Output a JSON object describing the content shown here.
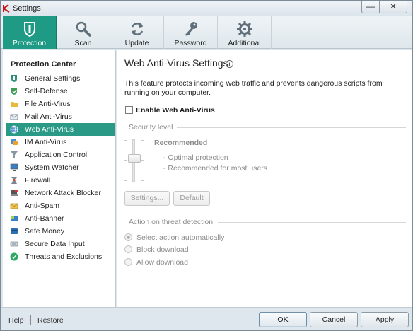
{
  "window": {
    "title": "Settings",
    "minimize_glyph": "—",
    "close_glyph": "✕"
  },
  "toolbar": {
    "tabs": [
      {
        "label": "Protection",
        "icon": "shield-icon",
        "active": true
      },
      {
        "label": "Scan",
        "icon": "magnifier-icon",
        "active": false
      },
      {
        "label": "Update",
        "icon": "refresh-icon",
        "active": false
      },
      {
        "label": "Password",
        "icon": "key-icon",
        "active": false
      },
      {
        "label": "Additional",
        "icon": "gear-icon",
        "active": false
      }
    ]
  },
  "sidebar": {
    "heading": "Protection Center",
    "items": [
      {
        "label": "General Settings",
        "icon": "general-settings-icon",
        "selected": false
      },
      {
        "label": "Self-Defense",
        "icon": "self-defense-icon",
        "selected": false
      },
      {
        "label": "File Anti-Virus",
        "icon": "folder-icon",
        "selected": false
      },
      {
        "label": "Mail Anti-Virus",
        "icon": "envelope-icon",
        "selected": false
      },
      {
        "label": "Web Anti-Virus",
        "icon": "globe-icon",
        "selected": true
      },
      {
        "label": "IM Anti-Virus",
        "icon": "chat-icon",
        "selected": false
      },
      {
        "label": "Application Control",
        "icon": "funnel-icon",
        "selected": false
      },
      {
        "label": "System Watcher",
        "icon": "monitor-icon",
        "selected": false
      },
      {
        "label": "Firewall",
        "icon": "firewall-icon",
        "selected": false
      },
      {
        "label": "Network Attack Blocker",
        "icon": "network-blocker-icon",
        "selected": false
      },
      {
        "label": "Anti-Spam",
        "icon": "anti-spam-icon",
        "selected": false
      },
      {
        "label": "Anti-Banner",
        "icon": "anti-banner-icon",
        "selected": false
      },
      {
        "label": "Safe Money",
        "icon": "safe-money-icon",
        "selected": false
      },
      {
        "label": "Secure Data Input",
        "icon": "keyboard-icon",
        "selected": false
      },
      {
        "label": "Threats and Exclusions",
        "icon": "check-circle-icon",
        "selected": false
      }
    ]
  },
  "main": {
    "title": "Web Anti-Virus Settings",
    "info_glyph": "i",
    "description": "This feature protects incoming web traffic and prevents dangerous scripts from running on your computer.",
    "enable_checkbox": {
      "label": "Enable Web Anti-Virus",
      "checked": false
    },
    "security_level": {
      "section_title": "Security level",
      "level_name": "Recommended",
      "level_details": [
        "- Optimal protection",
        "- Recommended for most users"
      ],
      "settings_button": "Settings...",
      "default_button": "Default"
    },
    "action": {
      "section_title": "Action on threat detection",
      "options": [
        {
          "label": "Select action automatically",
          "checked": true
        },
        {
          "label": "Block download",
          "checked": false
        },
        {
          "label": "Allow download",
          "checked": false
        }
      ]
    }
  },
  "footer": {
    "help_link": "Help",
    "restore_link": "Restore",
    "ok_button": "OK",
    "cancel_button": "Cancel",
    "apply_button": "Apply"
  },
  "colors": {
    "accent": "#1e9a85",
    "selected_row": "#2a9a87",
    "chrome": "#dfe7ee"
  }
}
